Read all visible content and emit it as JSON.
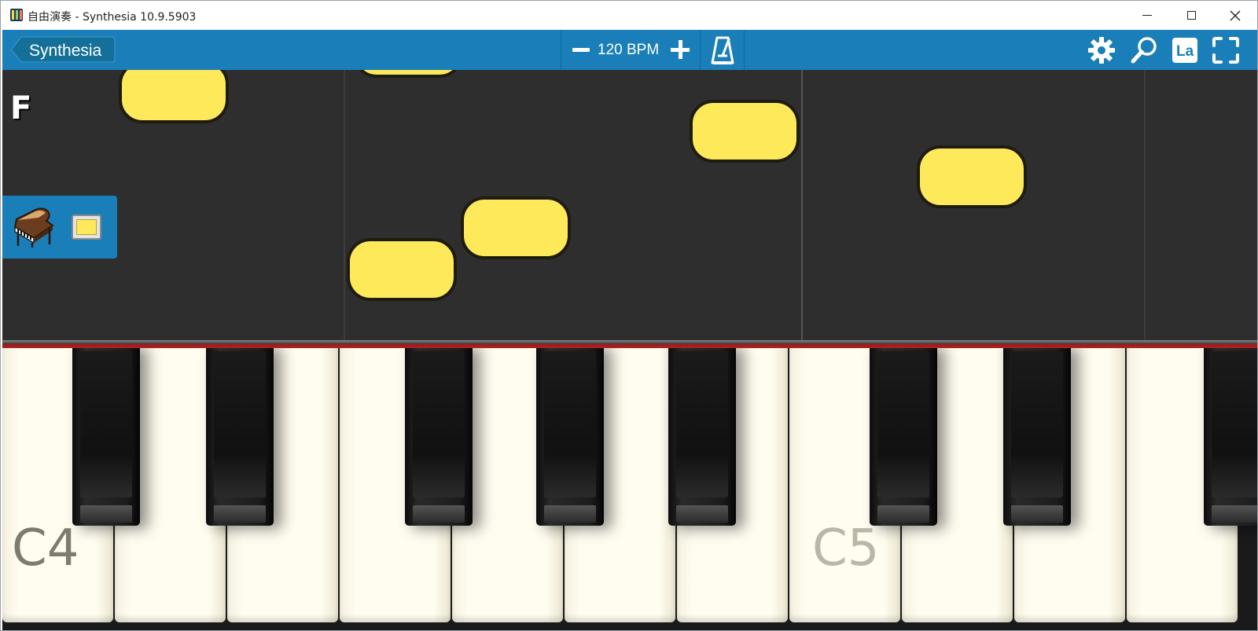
{
  "window": {
    "title": "自由演奏 - Synthesia 10.9.5903",
    "app_icon": "synthesia-icon"
  },
  "toolbar": {
    "back_label": "Synthesia",
    "tempo_text": "120 BPM",
    "icons": [
      "minus-icon",
      "plus-icon",
      "metronome-icon",
      "gear-icon",
      "magnifier-icon",
      "note-labels-icon",
      "fullscreen-icon"
    ],
    "labels_button_text": "La"
  },
  "note_area": {
    "key_signature": "F",
    "track": {
      "instrument_icon": "grand-piano-icon",
      "color": "#fde95a"
    }
  },
  "keyboard": {
    "labels": {
      "c4": "C4",
      "c5": "C5"
    }
  },
  "colors": {
    "toolbar": "#1a7fb8",
    "note": "#fde95a",
    "background": "#2e2e2e",
    "keyboard_rail": "#b52222"
  }
}
